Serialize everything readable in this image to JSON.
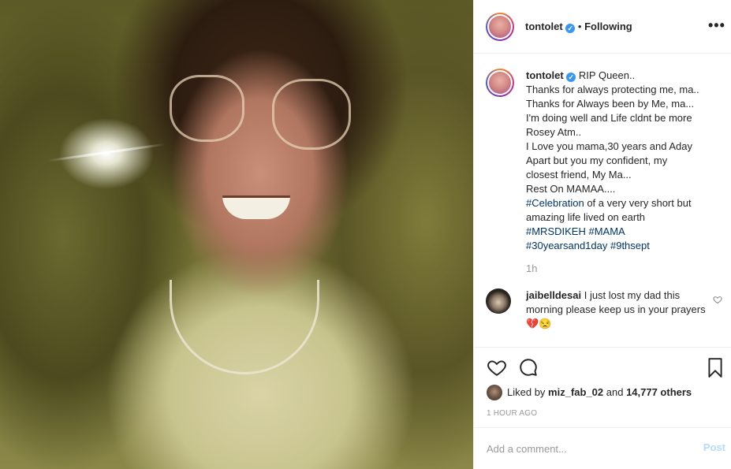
{
  "post": {
    "photo_alt": "",
    "author": {
      "username": "tontolet",
      "verified": true,
      "follow_status": "Following"
    },
    "caption_lines": [
      "RIP Queen..",
      "Thanks for always protecting me, ma..",
      "Thanks for Always been by Me, ma...",
      "I'm doing well and Life cldnt be more",
      "Rosey Atm..",
      "I Love you mama,30 years and Aday",
      "Apart but you my confident, my",
      "closest friend, My Ma...",
      "Rest On MAMAA...."
    ],
    "caption_hashtag_line1": {
      "tag": "#Celebration",
      "rest": " of a very very short but"
    },
    "caption_line_after": "amazing life lived on earth",
    "caption_hashtags_line2": [
      "#MRSDIKEH",
      "#MAMA"
    ],
    "caption_hashtags_line3": [
      "#30yearsand1day",
      "#9thsept"
    ],
    "caption_time": "1h",
    "comments": [
      {
        "username": "jaibelldesai",
        "text": "I just lost my dad this morning please keep us in your prayers 💔😒"
      }
    ],
    "likes": {
      "liked_by_prefix": "Liked by ",
      "liked_by_user": "miz_fab_02",
      "and_text": " and ",
      "others": "14,777 others"
    },
    "time_ago": "1 HOUR AGO",
    "add_comment_placeholder": "Add a comment...",
    "post_button": "Post"
  },
  "icons": {
    "more": "more-options-icon",
    "like": "heart-icon",
    "comment": "comment-bubble-icon",
    "save": "bookmark-icon",
    "verified": "verified-badge-icon"
  },
  "colors": {
    "link": "#003569",
    "verified": "#3897f0",
    "muted": "#999999",
    "post_disabled": "#b3dbff"
  }
}
